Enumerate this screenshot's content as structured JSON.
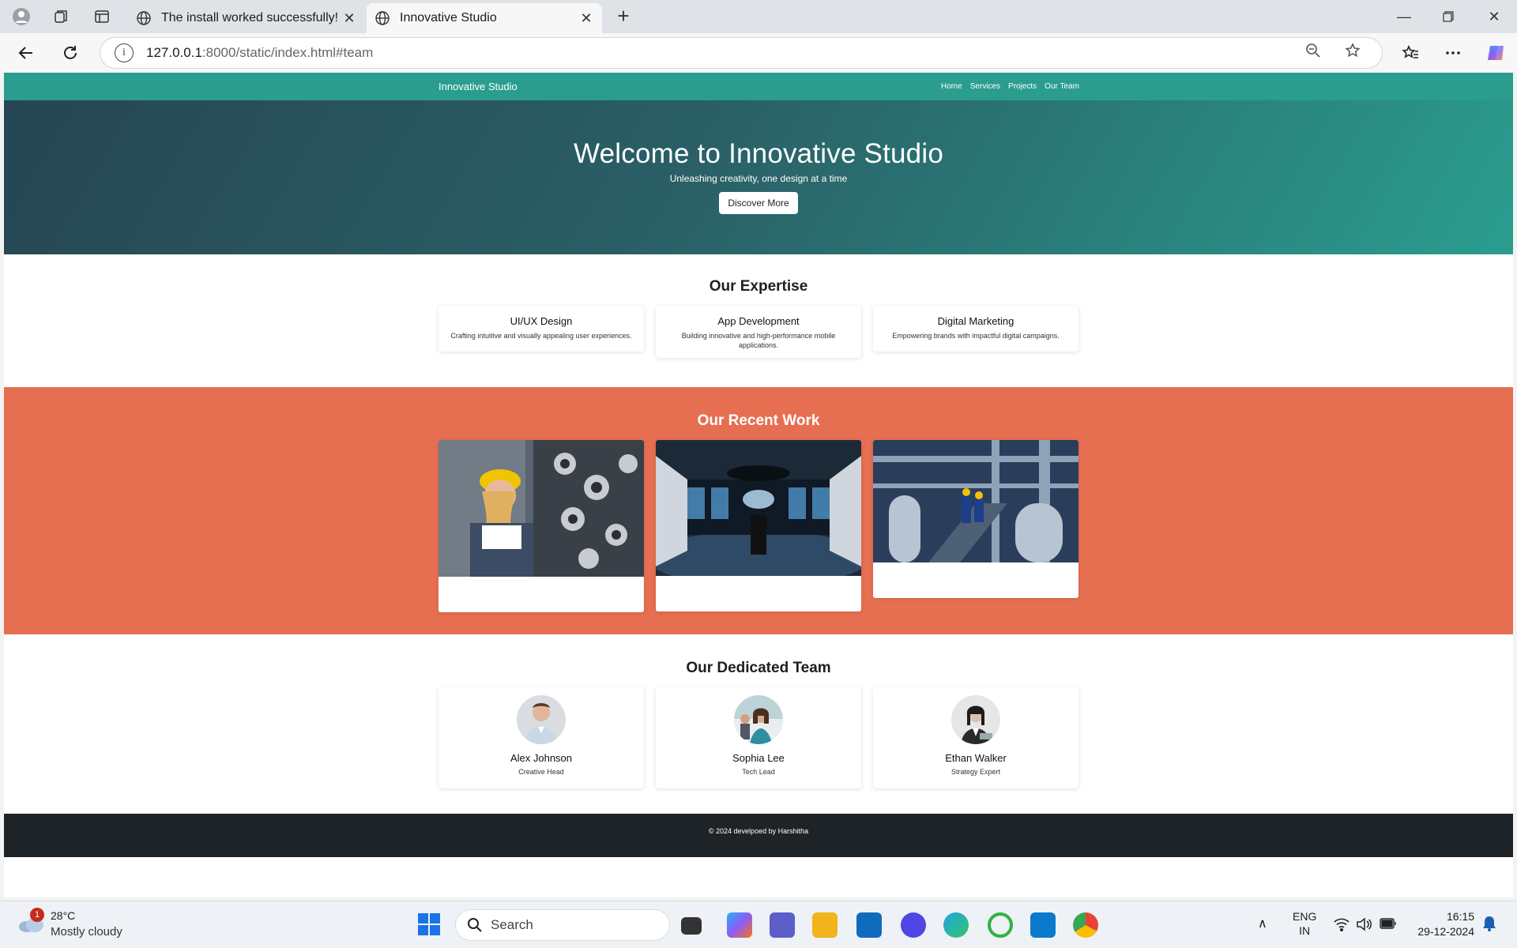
{
  "browser": {
    "tabs": [
      {
        "title": "The install worked successfully! Co",
        "active": false
      },
      {
        "title": "Innovative Studio",
        "active": true
      }
    ],
    "url_host": "127.0.0.1",
    "url_rest": ":8000/static/index.html#team"
  },
  "site": {
    "brand": "Innovative Studio",
    "nav": [
      "Home",
      "Services",
      "Projects",
      "Our Team"
    ],
    "hero": {
      "title": "Welcome to Innovative Studio",
      "subtitle": "Unleashing creativity, one design at a time",
      "cta": "Discover More"
    },
    "expertise": {
      "heading": "Our Expertise",
      "items": [
        {
          "title": "UI/UX Design",
          "desc": "Crafting intuitive and visually appealing user experiences."
        },
        {
          "title": "App Development",
          "desc": "Building innovative and high-performance mobile applications."
        },
        {
          "title": "Digital Marketing",
          "desc": "Empowering brands with impactful digital campaigns."
        }
      ]
    },
    "work": {
      "heading": "Our Recent Work"
    },
    "team": {
      "heading": "Our Dedicated Team",
      "members": [
        {
          "name": "Alex Johnson",
          "role": "Creative Head"
        },
        {
          "name": "Sophia Lee",
          "role": "Tech Lead"
        },
        {
          "name": "Ethan Walker",
          "role": "Strategy Expert"
        }
      ]
    },
    "footer": "© 2024 develpoed by Harshitha"
  },
  "taskbar": {
    "weather_badge": "1",
    "temp": "28°C",
    "condition": "Mostly cloudy",
    "search": "Search",
    "lang1": "ENG",
    "lang2": "IN",
    "time": "16:15",
    "date": "29-12-2024"
  },
  "colors": {
    "nav": "#2a9d8f",
    "hero_start": "#264653",
    "work_bg": "#e76f51",
    "footer": "#1d2327"
  }
}
